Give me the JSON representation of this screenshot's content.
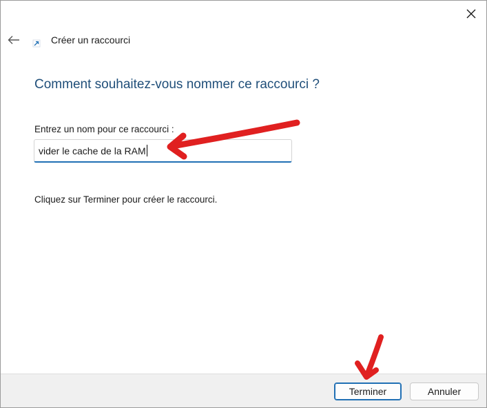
{
  "window": {
    "title": "Créer un raccourci"
  },
  "icons": {
    "close": "close-icon",
    "back": "back-arrow-icon",
    "shortcut": "shortcut-arrow-icon"
  },
  "page": {
    "heading": "Comment souhaitez-vous nommer ce raccourci ?",
    "field_label": "Entrez un nom pour ce raccourci :",
    "field_value": "vider le cache de la RAM",
    "instruction": "Cliquez sur Terminer pour créer le raccourci."
  },
  "footer": {
    "finish_label": "Terminer",
    "cancel_label": "Annuler"
  },
  "colors": {
    "heading": "#1f4e79",
    "accent": "#1f6fb4",
    "annotation_arrow": "#e02020"
  }
}
